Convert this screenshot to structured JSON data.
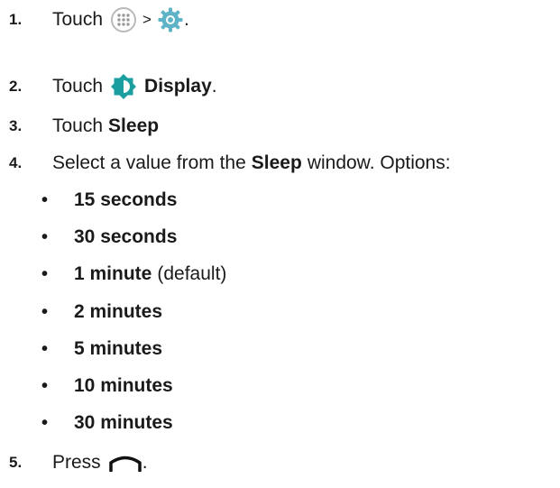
{
  "steps": [
    {
      "number": "1.",
      "text_a": "Touch",
      "sep": ">",
      "end": "."
    },
    {
      "number": "2.",
      "text_a": "Touch",
      "bold": "Display",
      "end": "."
    },
    {
      "number": "3.",
      "text_a": "Touch",
      "bold": "Sleep"
    },
    {
      "number": "4.",
      "text_a": "Select a value from the",
      "bold": "Sleep",
      "text_b": "window. Options:"
    },
    {
      "number": "5.",
      "text_a": "Press",
      "end": "."
    }
  ],
  "options": [
    {
      "label": "15 seconds",
      "note": ""
    },
    {
      "label": "30 seconds",
      "note": ""
    },
    {
      "label": "1 minute",
      "note": "(default)"
    },
    {
      "label": "2 minutes",
      "note": ""
    },
    {
      "label": "5 minutes",
      "note": ""
    },
    {
      "label": "10 minutes",
      "note": ""
    },
    {
      "label": "30 minutes",
      "note": ""
    }
  ],
  "bullet_char": "•",
  "icons": {
    "step1_first": "apps-grid-icon",
    "step1_second": "settings-gear-icon",
    "step2": "display-brightness-icon",
    "step5": "home-button-icon"
  },
  "colors": {
    "text": "#1a1a1a",
    "display_icon": "#1b9ea0",
    "gear_icon": "#5fb3c6",
    "apps_icon": "#b9b9b9"
  }
}
